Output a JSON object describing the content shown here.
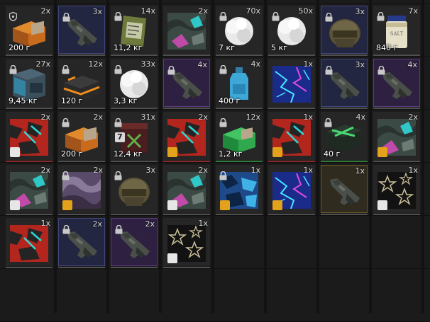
{
  "colors": {
    "background": "#1b1b1b",
    "cell": "#262626",
    "rare_purple": "#5a3a7a",
    "rare_blue": "#43467a",
    "rare_gold": "#6a5a28",
    "underline_default": "#505050",
    "underline_red": "#8a2a2a",
    "underline_green": "#2f7a3a"
  },
  "items": [
    {
      "row": 0,
      "col": 0,
      "count": "2x",
      "weight": "200 г",
      "icon": "shield-icon",
      "art": "orange-case-icon",
      "tier": "normal",
      "underline": "default"
    },
    {
      "row": 0,
      "col": 1,
      "count": "3x",
      "weight": "",
      "icon": "lock-icon",
      "art": "rifle-icon",
      "tier": "blue",
      "underline": "default"
    },
    {
      "row": 0,
      "col": 2,
      "count": "14x",
      "weight": "11,2 кг",
      "icon": "lock-icon",
      "art": "ration-pack-icon",
      "tier": "normal",
      "underline": "default"
    },
    {
      "row": 0,
      "col": 3,
      "count": "2x",
      "weight": "",
      "icon": "",
      "art": "camo-pattern-icon",
      "tier": "normal",
      "underline": "default"
    },
    {
      "row": 0,
      "col": 4,
      "count": "70x",
      "weight": "7 кг",
      "icon": "lock-icon",
      "art": "cotton-ball-icon",
      "tier": "normal",
      "underline": "default"
    },
    {
      "row": 0,
      "col": 5,
      "count": "50x",
      "weight": "5 кг",
      "icon": "lock-icon",
      "art": "cotton-ball-icon",
      "tier": "normal",
      "underline": "default"
    },
    {
      "row": 0,
      "col": 6,
      "count": "3x",
      "weight": "",
      "icon": "lock-icon",
      "art": "head-mask-icon",
      "tier": "blue",
      "underline": "default"
    },
    {
      "row": 0,
      "col": 7,
      "count": "7x",
      "weight": "840 г",
      "icon": "lock-icon",
      "art": "salt-jar-icon",
      "tier": "normal",
      "underline": "default"
    },
    {
      "row": 1,
      "col": 0,
      "count": "27x",
      "weight": "9,45 кг",
      "icon": "lock-icon",
      "art": "blue-crate-icon",
      "tier": "normal",
      "underline": "default"
    },
    {
      "row": 1,
      "col": 1,
      "count": "12x",
      "weight": "120 г",
      "icon": "lock-icon",
      "art": "black-orange-case-icon",
      "tier": "normal",
      "underline": "default"
    },
    {
      "row": 1,
      "col": 2,
      "count": "33x",
      "weight": "3,3 кг",
      "icon": "lock-icon",
      "art": "cotton-ball-icon",
      "tier": "normal",
      "underline": "default"
    },
    {
      "row": 1,
      "col": 3,
      "count": "4x",
      "weight": "",
      "icon": "lock-icon",
      "art": "rifle-icon",
      "tier": "purple",
      "underline": "default"
    },
    {
      "row": 1,
      "col": 4,
      "count": "4x",
      "weight": "400 г",
      "icon": "lock-icon",
      "art": "blue-bottle-icon",
      "tier": "normal",
      "underline": "default"
    },
    {
      "row": 1,
      "col": 5,
      "count": "1x",
      "weight": "",
      "icon": "",
      "art": "electric-pattern-icon",
      "tier": "normal",
      "underline": "default"
    },
    {
      "row": 1,
      "col": 6,
      "count": "3x",
      "weight": "",
      "icon": "lock-icon",
      "art": "rifle-icon",
      "tier": "blue",
      "underline": "default"
    },
    {
      "row": 1,
      "col": 7,
      "count": "4x",
      "weight": "",
      "icon": "lock-icon",
      "art": "rifle-icon",
      "tier": "purple",
      "underline": "default"
    },
    {
      "row": 2,
      "col": 0,
      "count": "2x",
      "weight": "",
      "icon": "",
      "art": "red-camo-icon",
      "tier": "normal",
      "underline": "red",
      "sticker": "white"
    },
    {
      "row": 2,
      "col": 1,
      "count": "2x",
      "weight": "200 г",
      "icon": "lock-icon",
      "art": "orange-case-icon",
      "tier": "normal",
      "underline": "default"
    },
    {
      "row": 2,
      "col": 2,
      "count": "31x",
      "weight": "12,4 кг",
      "icon": "lock-icon",
      "art": "green-canister-icon",
      "tier": "normal",
      "underline": "default",
      "badge": "7"
    },
    {
      "row": 2,
      "col": 3,
      "count": "2x",
      "weight": "",
      "icon": "",
      "art": "red-camo-icon",
      "tier": "normal",
      "underline": "red",
      "sticker": "orange"
    },
    {
      "row": 2,
      "col": 4,
      "count": "12x",
      "weight": "1,2 кг",
      "icon": "lock-icon",
      "art": "green-case-icon",
      "tier": "normal",
      "underline": "green"
    },
    {
      "row": 2,
      "col": 5,
      "count": "1x",
      "weight": "",
      "icon": "",
      "art": "red-camo-icon",
      "tier": "normal",
      "underline": "red",
      "sticker": "orange"
    },
    {
      "row": 2,
      "col": 6,
      "count": "4x",
      "weight": "40 г",
      "icon": "lock-icon",
      "art": "green-box-icon",
      "tier": "normal",
      "underline": "green"
    },
    {
      "row": 2,
      "col": 7,
      "count": "2x",
      "weight": "",
      "icon": "",
      "art": "camo-pattern-icon",
      "tier": "normal",
      "underline": "default",
      "sticker": "orange"
    },
    {
      "row": 3,
      "col": 0,
      "count": "2x",
      "weight": "",
      "icon": "",
      "art": "camo-pattern-icon",
      "tier": "normal",
      "underline": "default",
      "sticker": "white"
    },
    {
      "row": 3,
      "col": 1,
      "count": "2x",
      "weight": "",
      "icon": "lock-icon",
      "art": "marble-pattern-icon",
      "tier": "normal",
      "underline": "default",
      "sticker": "orange"
    },
    {
      "row": 3,
      "col": 2,
      "count": "3x",
      "weight": "",
      "icon": "lock-icon",
      "art": "head-mask-icon",
      "tier": "normal",
      "underline": "default"
    },
    {
      "row": 3,
      "col": 3,
      "count": "2x",
      "weight": "",
      "icon": "",
      "art": "camo-pattern-icon",
      "tier": "normal",
      "underline": "default",
      "sticker": "white"
    },
    {
      "row": 3,
      "col": 4,
      "count": "1x",
      "weight": "",
      "icon": "lock-icon",
      "art": "blue-camo-icon",
      "tier": "normal",
      "underline": "default",
      "sticker": "orange"
    },
    {
      "row": 3,
      "col": 5,
      "count": "1x",
      "weight": "",
      "icon": "",
      "art": "electric-pattern-icon",
      "tier": "normal",
      "underline": "default",
      "sticker": "orange"
    },
    {
      "row": 3,
      "col": 6,
      "count": "1x",
      "weight": "",
      "icon": "",
      "art": "rifle-icon",
      "tier": "gold",
      "underline": "default"
    },
    {
      "row": 3,
      "col": 7,
      "count": "1x",
      "weight": "",
      "icon": "",
      "art": "star-pattern-icon",
      "tier": "normal",
      "underline": "default",
      "sticker": "white"
    },
    {
      "row": 4,
      "col": 0,
      "count": "1x",
      "weight": "",
      "icon": "",
      "art": "red-camo-icon",
      "tier": "normal",
      "underline": "default"
    },
    {
      "row": 4,
      "col": 1,
      "count": "2x",
      "weight": "",
      "icon": "lock-icon",
      "art": "rifle-icon",
      "tier": "blue",
      "underline": "default"
    },
    {
      "row": 4,
      "col": 2,
      "count": "2x",
      "weight": "",
      "icon": "lock-icon",
      "art": "rifle-icon",
      "tier": "purple",
      "underline": "default"
    },
    {
      "row": 4,
      "col": 3,
      "count": "1x",
      "weight": "",
      "icon": "",
      "art": "star-pattern-icon",
      "tier": "normal",
      "underline": "default",
      "sticker": "white"
    }
  ]
}
